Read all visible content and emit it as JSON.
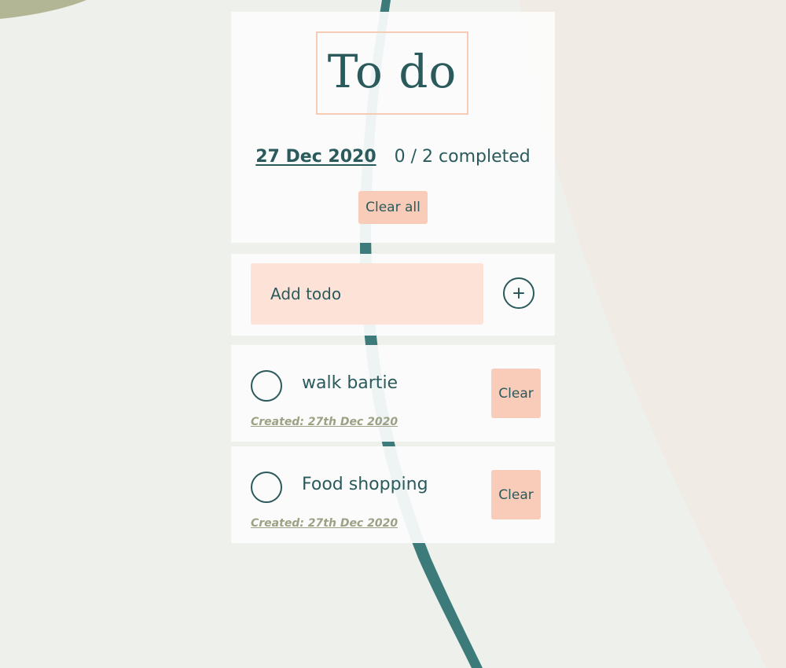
{
  "header": {
    "title": "To do",
    "date": "27 Dec 2020",
    "completed": "0 / 2 completed",
    "clear_all_label": "Clear all"
  },
  "add": {
    "placeholder": "Add todo",
    "button_icon": "plus-icon"
  },
  "todos": [
    {
      "text": "walk bartie",
      "created": "Created: 27th Dec 2020",
      "clear_label": "Clear",
      "done": false
    },
    {
      "text": "Food shopping",
      "created": "Created: 27th Dec 2020",
      "clear_label": "Clear",
      "done": false
    }
  ],
  "colors": {
    "background": "#eef0ec",
    "card": "#fcfcfc",
    "text": "#2a5a5c",
    "accent": "#f8ccb8",
    "input": "#fde3d7",
    "muted": "#9da184",
    "stripe": "#3d7b7b"
  }
}
